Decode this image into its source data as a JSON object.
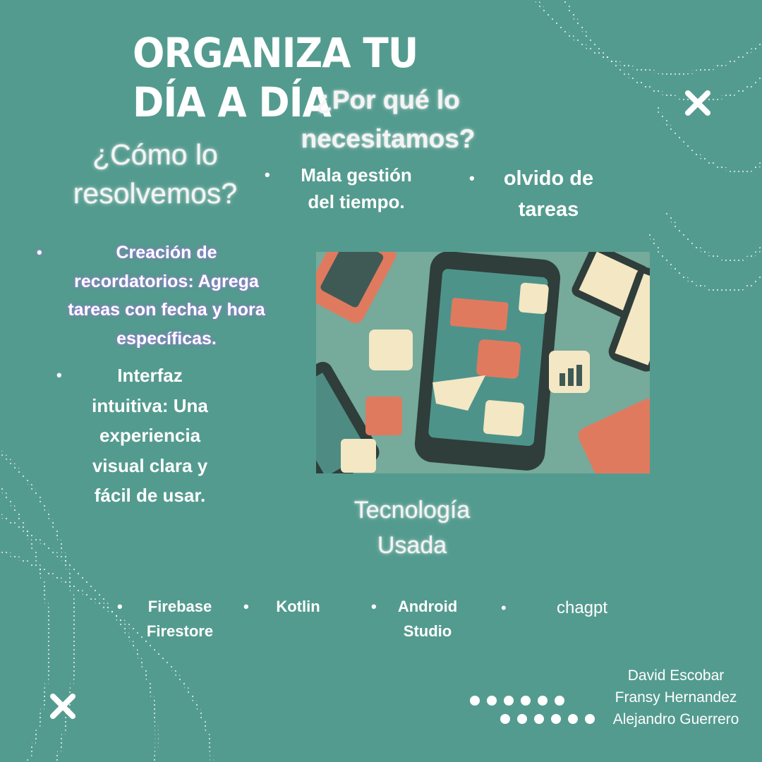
{
  "title": "ORGANIZA TU DÍA A DÍA",
  "why": {
    "heading": "¿Por qué lo necesitamos?",
    "items": [
      "Mala gestión del tiempo.",
      "olvido de tareas"
    ]
  },
  "how": {
    "heading": "¿Cómo lo resolvemos?",
    "items": [
      "Creación de recordatorios: Agrega tareas con fecha y hora específicas.",
      "Interfaz intuitiva: Una experiencia visual clara y fácil de usar."
    ]
  },
  "tech": {
    "heading": "Tecnología Usada",
    "items": [
      "Firebase Firestore",
      "Kotlin",
      "Android Studio",
      "chagpt"
    ]
  },
  "authors": [
    "David Escobar",
    "Fransy Hernandez",
    "Alejandro Guerrero"
  ],
  "icons": [
    "close-x-icon",
    "close-x-icon",
    "dots-decoration"
  ],
  "colors": {
    "background": "#549b8f",
    "accent_coral": "#e07a5f",
    "cream": "#f3e7c4",
    "dark": "#2f3e3a"
  }
}
